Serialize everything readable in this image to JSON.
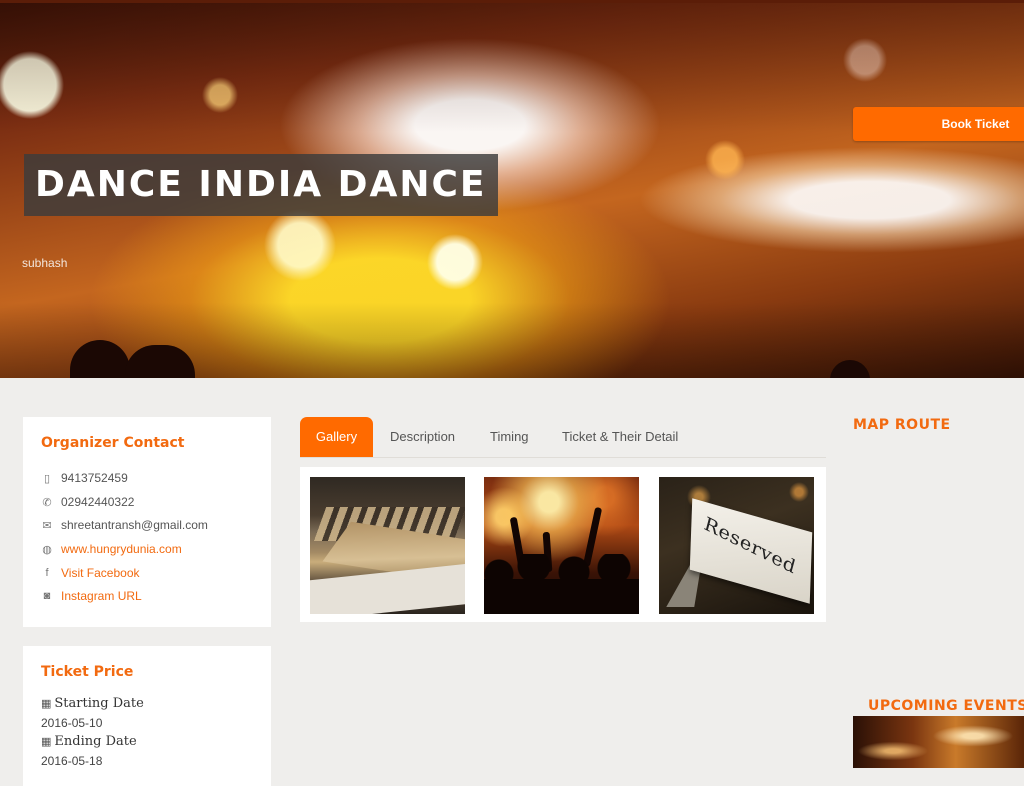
{
  "hero": {
    "title": "DANCE INDIA DANCE",
    "organizer_partial": "subhash",
    "book_button": "Book Ticket"
  },
  "organizer": {
    "heading": "Organizer Contact",
    "mobile": {
      "icon": "mobile-icon",
      "value": "9413752459"
    },
    "phone": {
      "icon": "phone-icon",
      "value": "02942440322"
    },
    "email": {
      "icon": "envelope-icon",
      "value": "shreetantransh@gmail.com"
    },
    "website": {
      "icon": "globe-icon",
      "value": "www.hungrydunia.com"
    },
    "facebook": {
      "icon": "facebook-icon",
      "value": "Visit Facebook"
    },
    "instagram": {
      "icon": "instagram-icon",
      "value": "Instagram URL"
    }
  },
  "ticket_price": {
    "heading": "Ticket Price",
    "starting_label": "Starting Date",
    "starting_value": "2016-05-10",
    "ending_label": "Ending Date",
    "ending_value": "2016-05-18",
    "calendar_icon": "calendar-icon"
  },
  "tabs": [
    {
      "label": "Gallery",
      "active": true
    },
    {
      "label": "Description",
      "active": false
    },
    {
      "label": "Timing",
      "active": false
    },
    {
      "label": "Ticket & Their Detail",
      "active": false
    }
  ],
  "gallery": {
    "images": [
      {
        "subject": "banquet-table-photo"
      },
      {
        "subject": "concert-crowd-photo"
      },
      {
        "subject": "reserved-sign-photo",
        "sign_text": "Reserved"
      }
    ]
  },
  "sidebar": {
    "map_heading": "MAP ROUTE",
    "upcoming_heading": "UPCOMING EVENTS"
  },
  "colors": {
    "accent": "#ff6a00",
    "heading": "#f26a10",
    "background": "#efeeec"
  }
}
